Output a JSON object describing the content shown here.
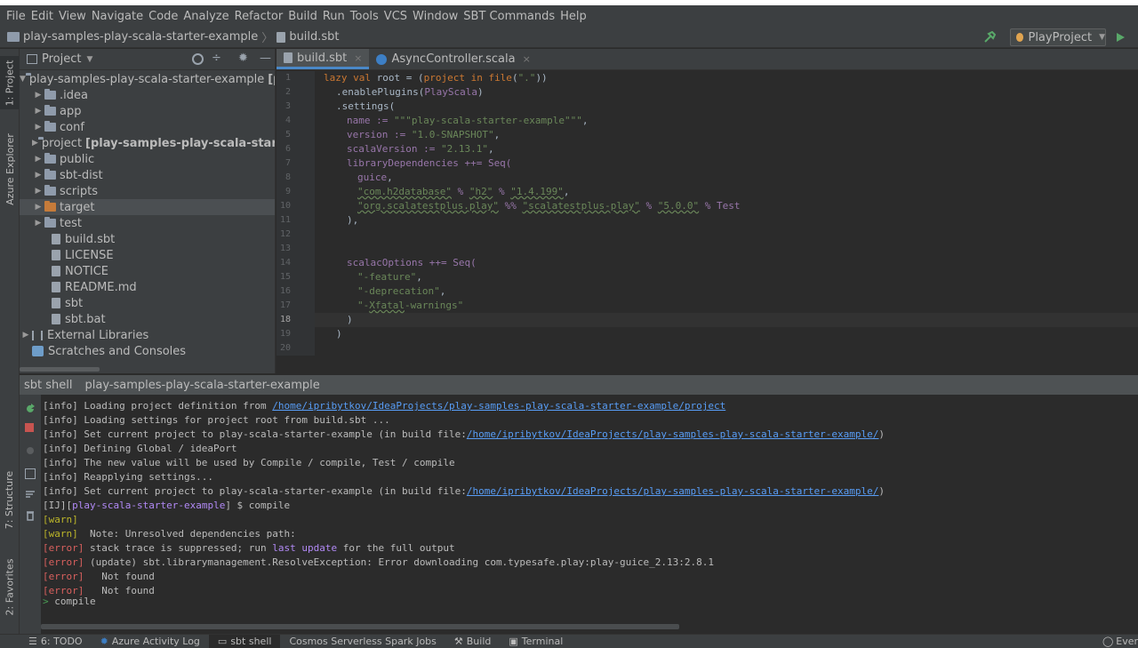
{
  "menu": [
    "File",
    "Edit",
    "View",
    "Navigate",
    "Code",
    "Analyze",
    "Refactor",
    "Build",
    "Run",
    "Tools",
    "VCS",
    "Window",
    "SBT Commands",
    "Help"
  ],
  "breadcrumb": {
    "project": "play-samples-play-scala-starter-example",
    "file": "build.sbt"
  },
  "run_config": "PlayProject",
  "left_tabs": {
    "project": "1: Project",
    "azure": "Azure Explorer",
    "structure": "7: Structure",
    "favorites": "2: Favorites"
  },
  "project_panel": {
    "title": "Project",
    "root": {
      "name": "play-samples-play-scala-starter-example",
      "suffix": "[pl"
    },
    "items": [
      {
        "label": ".idea",
        "suffix": ""
      },
      {
        "label": "app",
        "suffix": ""
      },
      {
        "label": "conf",
        "suffix": ""
      },
      {
        "label": "project",
        "suffix": "[play-samples-play-scala-starte"
      },
      {
        "label": "public",
        "suffix": ""
      },
      {
        "label": "sbt-dist",
        "suffix": ""
      },
      {
        "label": "scripts",
        "suffix": ""
      },
      {
        "label": "target",
        "suffix": ""
      },
      {
        "label": "test",
        "suffix": ""
      }
    ],
    "files": [
      "build.sbt",
      "LICENSE",
      "NOTICE",
      "README.md",
      "sbt",
      "sbt.bat"
    ],
    "external_libraries": "External Libraries",
    "scratches": "Scratches and Consoles"
  },
  "editor_tabs": [
    "build.sbt",
    "AsyncController.scala"
  ],
  "line_numbers": [
    "1",
    "2",
    "3",
    "4",
    "5",
    "6",
    "7",
    "8",
    "9",
    "10",
    "11",
    "12",
    "13",
    "14",
    "15",
    "16",
    "17",
    "18",
    "19",
    "20"
  ],
  "code": {
    "l1": {
      "a": "lazy val",
      "b": " root = (",
      "c": "project in file",
      "d": "(",
      "e": "\".\"",
      "f": "))"
    },
    "l2": {
      "a": ".enablePlugins(",
      "b": "PlayScala",
      "c": ")"
    },
    "l3": ".settings(",
    "l4": {
      "a": "name := ",
      "b": "\"\"\"play-scala-starter-example\"\"\"",
      "c": ","
    },
    "l5": {
      "a": "version := ",
      "b": "\"1.0-SNAPSHOT\"",
      "c": ","
    },
    "l6": {
      "a": "scalaVersion := ",
      "b": "\"2.13.1\"",
      "c": ","
    },
    "l7": {
      "a": "libraryDependencies ++= Seq("
    },
    "l8": {
      "a": "guice",
      "b": ","
    },
    "l9": {
      "a": "\"com.h2database\"",
      "b": " % ",
      "c": "\"h2\"",
      "d": " % ",
      "e": "\"1.4.199\"",
      "f": ","
    },
    "l10": {
      "a": "\"org.scalatestplus.play\"",
      "b": " %% ",
      "c": "\"scalatestplus-play\"",
      "d": " % ",
      "e": "\"5.0.0\"",
      "f": " % Test"
    },
    "l11": "),",
    "l14": {
      "a": "scalacOptions ++= Seq("
    },
    "l15": {
      "a": "\"-feature\"",
      "b": ","
    },
    "l16": {
      "a": "\"-deprecation\"",
      "b": ","
    },
    "l17": {
      "a": "\"-",
      "b": "Xfatal",
      "c": "-warnings\""
    },
    "l18": ")",
    "l19": ")"
  },
  "shell": {
    "tab_label": "sbt shell",
    "project_label": "play-samples-play-scala-starter-example",
    "lines": {
      "s1": {
        "a": "[info] Loading project definition from ",
        "b": "/home/ipribytkov/IdeaProjects/play-samples-play-scala-starter-example/project"
      },
      "s2": "[info] Loading settings for project root from build.sbt ...",
      "s3": {
        "a": "[info] Set current project to play-scala-starter-example (in build file:",
        "b": "/home/ipribytkov/IdeaProjects/play-samples-play-scala-starter-example/",
        "c": ")"
      },
      "s4": "[info] Defining Global / ideaPort",
      "s5": "[info] The new value will be used by Compile / compile, Test / compile",
      "s6": "[info] Reapplying settings...",
      "s7": {
        "a": "[info] Set current project to play-scala-starter-example (in build file:",
        "b": "/home/ipribytkov/IdeaProjects/play-samples-play-scala-starter-example/",
        "c": ")"
      },
      "s8": {
        "a": "[IJ][",
        "b": "play-scala-starter-example",
        "c": "] $ compile"
      },
      "s9": {
        "a": "[warn]"
      },
      "s10": {
        "a": "[warn]",
        "b": "  Note: Unresolved dependencies path:"
      },
      "s11": {
        "a": "[error]",
        "b": " stack trace is suppressed; run ",
        "c": "last update",
        "d": " for the full output"
      },
      "s12": {
        "a": "[error]",
        "b": " (update) sbt.librarymanagement.ResolveException: Error downloading com.typesafe.play:play-guice_2.13:2.8.1"
      },
      "s13": {
        "a": "[error]",
        "b": "   Not found"
      },
      "s14": {
        "a": "[error]",
        "b": "   Not found"
      },
      "s15": {
        "a": ">",
        "b": " compile"
      }
    }
  },
  "bottom_tabs": [
    "6: TODO",
    "Azure Activity Log",
    "sbt shell",
    "Cosmos Serverless Spark Jobs",
    "Build",
    "Terminal"
  ],
  "event_log": "Ever",
  "colors": {
    "accent": "#4a88c7",
    "error": "#d8605e",
    "warn": "#bbb529",
    "link": "#589df6"
  }
}
